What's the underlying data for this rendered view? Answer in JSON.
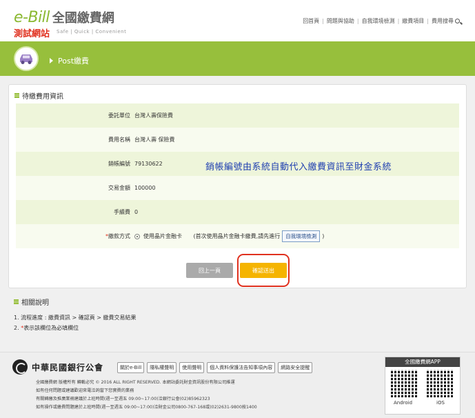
{
  "header": {
    "logo_ebill": "e-Bill",
    "logo_cn": "全國繳費網",
    "logo_test": "測試網站",
    "logo_tagline": "Safe | Quick | Convenient",
    "nav": [
      "回首頁",
      "問題與協助",
      "自我環境檢測",
      "繳費項目",
      "費用搜尋"
    ]
  },
  "banner": {
    "title": "Post繳費"
  },
  "pending": {
    "heading": "待繳費用資訊",
    "rows": [
      {
        "label": "委託單位",
        "value": "台灣人壽保險費"
      },
      {
        "label": "費用名稱",
        "value": "台灣人壽 保險費"
      },
      {
        "label": "銷帳編號",
        "value": "79130622"
      },
      {
        "label": "交易金額",
        "value": "100000"
      },
      {
        "label": "手續費",
        "value": "0"
      }
    ],
    "method_label": "繳款方式",
    "method_option": "使用晶片金融卡",
    "method_note_prefix": "(首次使用晶片金融卡繳費,請先進行",
    "env_check": "自我環境檢測",
    "method_note_suffix": ")",
    "annotation": "銷帳編號由系統自動代入繳費資訊至財金系統",
    "back_label": "回上一頁",
    "confirm_label": "確認送出"
  },
  "info": {
    "heading": "相關說明",
    "item1": "1. 流程進度 : 繳費資訊 > 確認頁 > 繳費交易結果",
    "item2_prefix": "2. ",
    "item2_star": "*",
    "item2_text": "表示該欄位為必填欄位"
  },
  "footer": {
    "bank_name": "中華民國銀行公會",
    "links": [
      "關於e-Bill",
      "隱私權聲明",
      "使用聲明",
      "個人資料保護法告知事項內容",
      "網路安全提醒"
    ],
    "lines": [
      "全國繳費網 版權所有 轉載必究 © 2016 ALL RIGHT RESERVED. 本網站委託財金資訊股份有限公司維運",
      "如有任何問題或建議歡迎來電洽詢當下您實費的業務",
      "有關轉繳及推廣業務建議於上班時間(週一至週五 09:00~17:00)洽銀行公會(02)85962323",
      "如有操作或繳費問題建於上班時間(週一至週五 09:00~17:00)洽財金公司0800-767-168或(02)2631-9800按1400"
    ],
    "app_title": "全國繳費網APP",
    "android": "Android",
    "ios": "iOS"
  }
}
